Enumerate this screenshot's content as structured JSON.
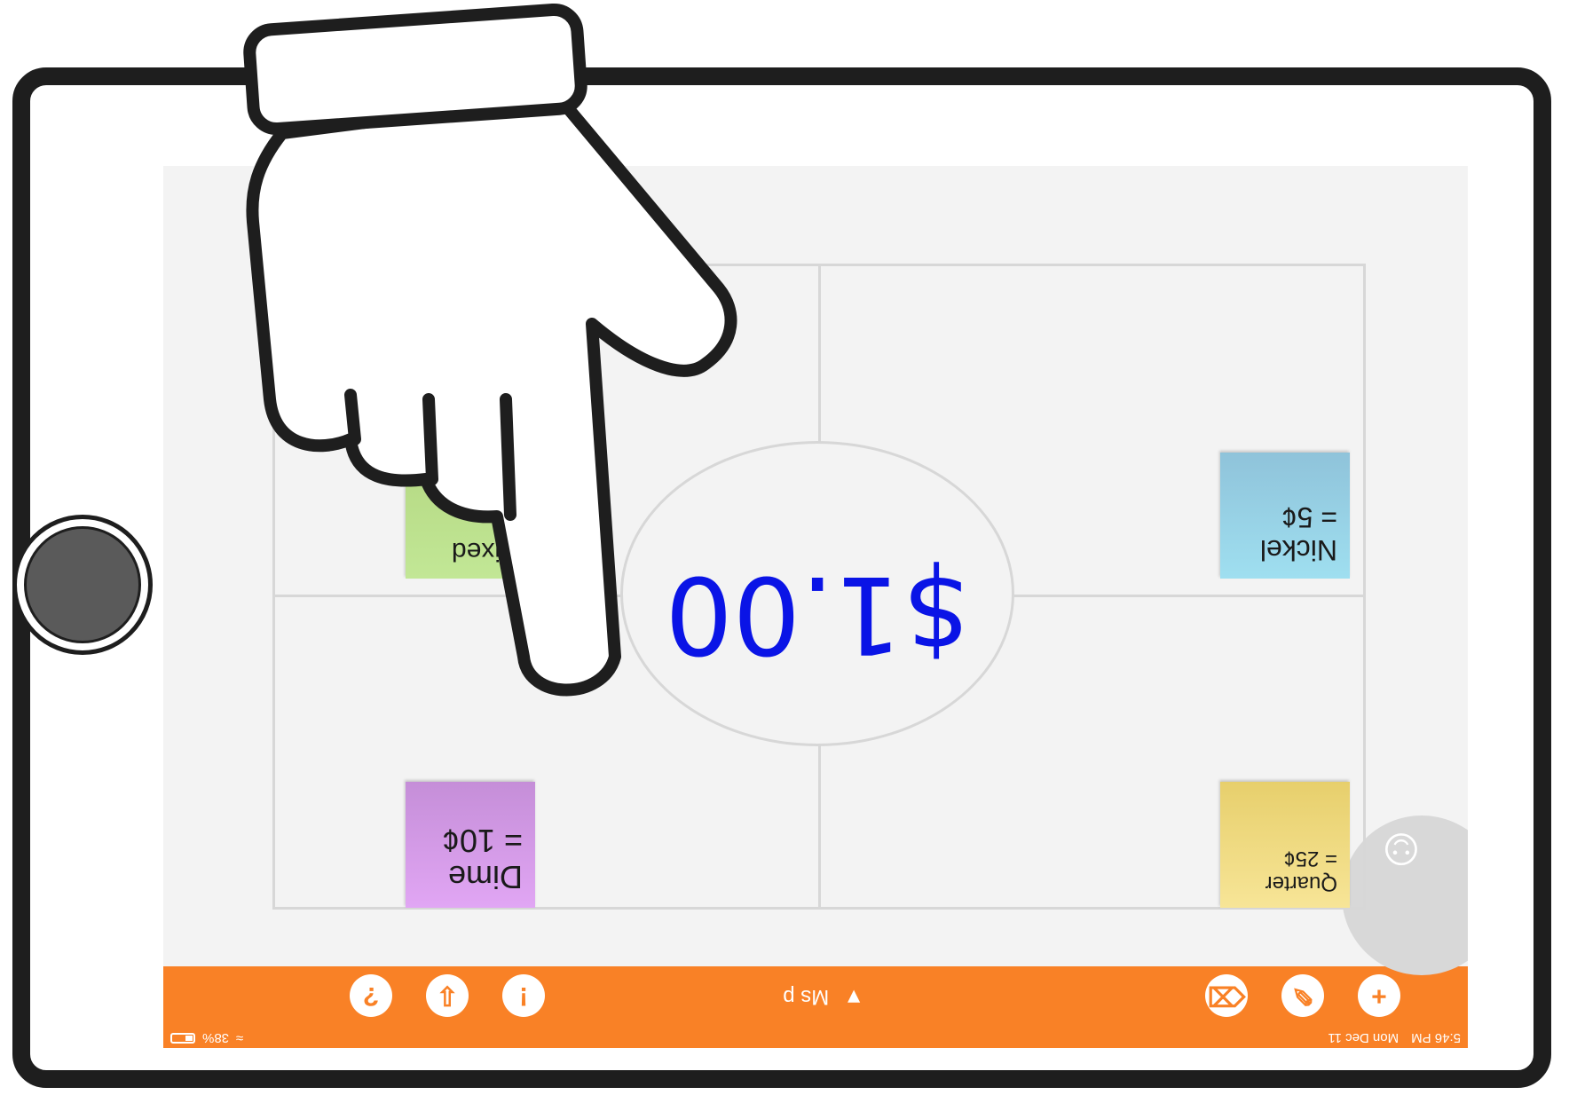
{
  "status": {
    "time": "5:46 PM",
    "date": "Mon Dec 11",
    "battery": "38%"
  },
  "toolbar": {
    "user": "Ms p",
    "user_caret": "▼",
    "help_label": "?",
    "export_label": "⇩",
    "alert_label": "!",
    "eraser_label": "⌫",
    "pencil_label": "✎",
    "add_label": "+"
  },
  "board": {
    "center_text": "$1.00",
    "stickies": {
      "dime_line1": "Dime",
      "dime_line2": "= 10¢",
      "quarter_line1": "Quarter",
      "quarter_line2": "= 25¢",
      "nickel_line1": "Nickel",
      "nickel_line2": "= 5¢",
      "mixed_line1": "Mixed",
      "mixed_line2": ""
    }
  },
  "colors": {
    "accent": "#f98126",
    "ink": "#0a14e6",
    "board_bg": "#f3f3f3"
  }
}
